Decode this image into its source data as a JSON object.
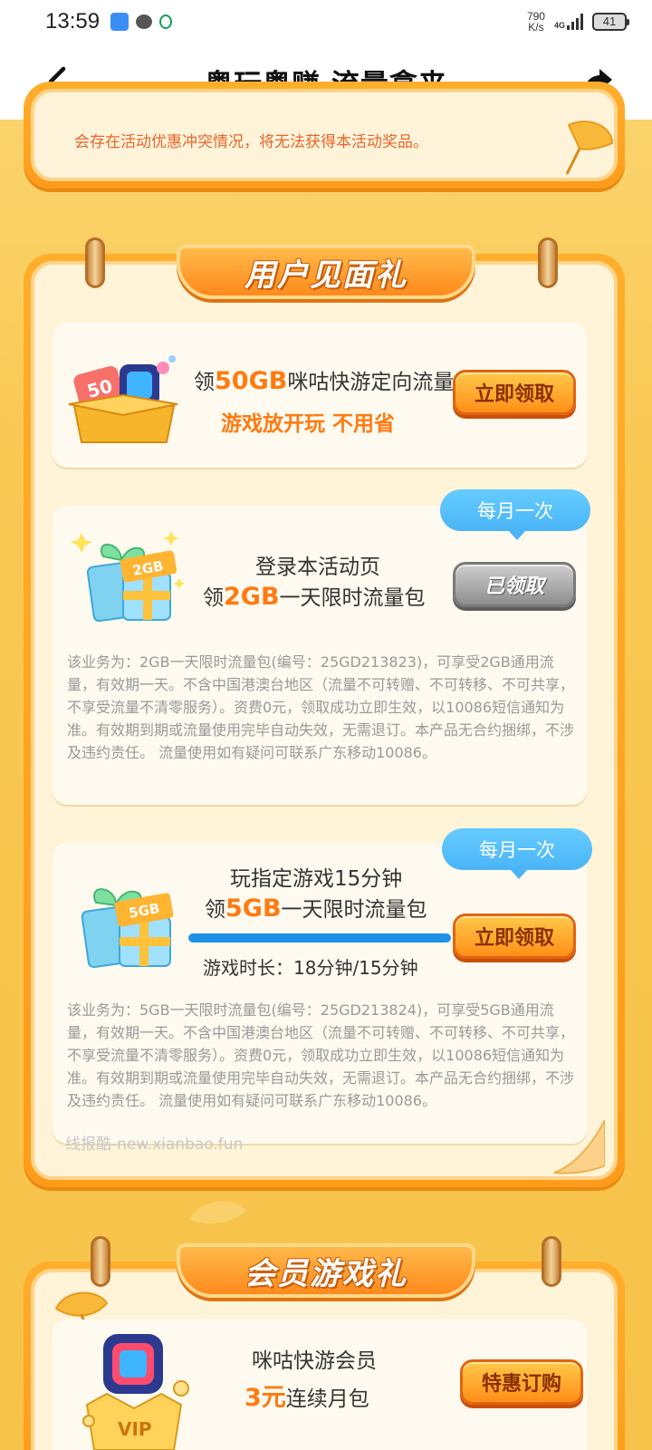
{
  "status_bar": {
    "time": "13:59",
    "net_speed_value": "790",
    "net_speed_unit": "K/s",
    "net_type": "4G",
    "battery": "41",
    "icons": [
      "cloud-icon",
      "chat-icon",
      "mobile-carrier-icon",
      "signal-icon",
      "battery-icon"
    ]
  },
  "nav": {
    "title": "粤玩粤赚 流量拿来",
    "back_icon": "back-arrow-icon",
    "share_icon": "share-arrow-icon"
  },
  "top_card": {
    "cut_text": "会存在活动优惠冲突情况，将无法获得本活动奖品。"
  },
  "gift_section": {
    "banner": "用户见面礼",
    "item1": {
      "line1_prefix": "领",
      "line1_highlight": "50GB",
      "line1_suffix": "咪咕快游定向流量",
      "line2": "游戏放开玩 不用省",
      "button": "立即领取",
      "box_label": "50"
    },
    "item2": {
      "badge": "每月一次",
      "line1": "登录本活动页",
      "line2_prefix": "领",
      "line2_highlight": "2GB",
      "line2_suffix": "一天限时流量包",
      "button": "已领取",
      "box_label": "2GB",
      "fine_print": "该业务为：2GB一天限时流量包(编号：25GD213823)，可享受2GB通用流量，有效期一天。不含中国港澳台地区（流量不可转赠、不可转移、不可共享，不享受流量不清零服务）。资费0元，领取成功立即生效，以10086短信通知为准。有效期到期或流量使用完毕自动失效，无需退订。本产品无合约捆绑，不涉及违约责任。 流量使用如有疑问可联系广东移动10086。"
    },
    "item3": {
      "badge": "每月一次",
      "line1": "玩指定游戏15分钟",
      "line2_prefix": "领",
      "line2_highlight": "5GB",
      "line2_suffix": "一天限时流量包",
      "button": "立即领取",
      "progress_label": "游戏时长：18分钟/15分钟",
      "progress": 1.0,
      "box_label": "5GB",
      "fine_print": "该业务为：5GB一天限时流量包(编号：25GD213824)，可享受5GB通用流量，有效期一天。不含中国港澳台地区（流量不可转赠、不可转移、不可共享，不享受流量不清零服务）。资费0元，领取成功立即生效，以10086短信通知为准。有效期到期或流量使用完毕自动失效，无需退订。本产品无合约捆绑，不涉及违约责任。 流量使用如有疑问可联系广东移动10086。"
    },
    "watermark": "线报酷-new.xianbao.fun"
  },
  "member_section": {
    "banner": "会员游戏礼",
    "item1": {
      "line1": "咪咕快游会员",
      "line2_highlight": "3元",
      "line2_suffix": "连续月包",
      "button": "特惠订购",
      "crown_label": "VIP"
    }
  },
  "colors": {
    "accent_orange": "#ff7a10",
    "badge_blue": "#4ab4f7",
    "progress_blue": "#1e90e8",
    "background_yellow": "#f9c955"
  }
}
